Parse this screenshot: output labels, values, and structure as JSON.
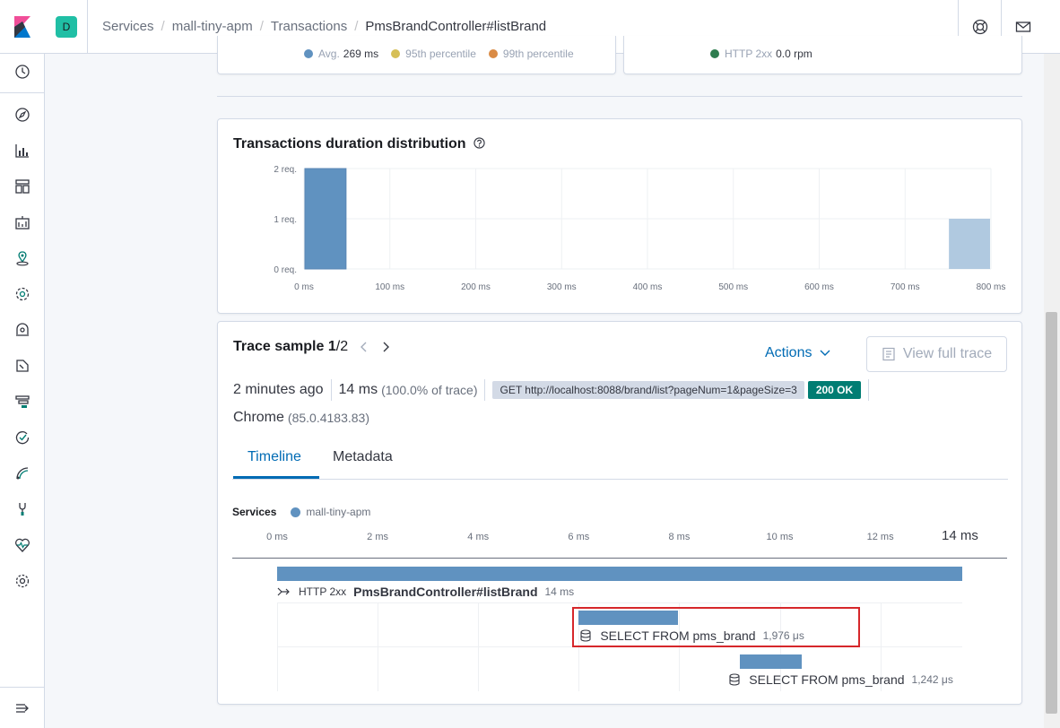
{
  "breadcrumbs": [
    "Services",
    "mall-tiny-apm",
    "Transactions",
    "PmsBrandController#listBrand"
  ],
  "space_initial": "D",
  "colors": {
    "accent": "#006bb4",
    "bar": "#6092c0",
    "bar_light": "#b0c9e0",
    "success": "#017d73",
    "highlight": "#d6272b"
  },
  "latency_legend": [
    {
      "label": "Avg.",
      "value": "269 ms",
      "color": "#6092c0"
    },
    {
      "label": "95th percentile",
      "value": "",
      "color": "#d6bf57"
    },
    {
      "label": "99th percentile",
      "value": "",
      "color": "#da8b45"
    }
  ],
  "throughput_legend": [
    {
      "label": "HTTP 2xx",
      "value": "0.0 rpm",
      "color": "#2e7d4f"
    }
  ],
  "distribution": {
    "title": "Transactions duration distribution"
  },
  "chart_data": {
    "type": "bar",
    "title": "Transactions duration distribution",
    "x_ticks": [
      "0 ms",
      "100 ms",
      "200 ms",
      "300 ms",
      "400 ms",
      "500 ms",
      "600 ms",
      "700 ms",
      "800 ms"
    ],
    "y_ticks": [
      "0 req.",
      "1 req.",
      "2 req."
    ],
    "xlim": [
      0,
      800
    ],
    "ylim": [
      0,
      2
    ],
    "bins": [
      {
        "x0": 0,
        "x1": 50,
        "value": 2,
        "selected": true
      },
      {
        "x0": 750,
        "x1": 800,
        "value": 1,
        "selected": false
      }
    ]
  },
  "trace": {
    "title": "Trace sample",
    "current": "1",
    "total": "/2",
    "actions_label": "Actions",
    "view_full_trace_label": "View full trace",
    "time_ago": "2 minutes ago",
    "duration": "14 ms",
    "duration_pct": "(100.0% of trace)",
    "request": "GET http://localhost:8088/brand/list?pageNum=1&pageSize=3",
    "status": "200 OK",
    "browser": "Chrome",
    "browser_version": "(85.0.4183.83)"
  },
  "tabs": [
    "Timeline",
    "Metadata"
  ],
  "timeline": {
    "services_label": "Services",
    "service_name": "mall-tiny-apm",
    "ticks": [
      "0 ms",
      "2 ms",
      "4 ms",
      "6 ms",
      "8 ms",
      "10 ms",
      "12 ms"
    ],
    "end_label": "14 ms",
    "total_ms": 13.63,
    "spans": [
      {
        "type": "HTTP 2xx",
        "name": "PmsBrandController#listBrand",
        "duration": "14 ms",
        "start_ms": 0,
        "length_ms": 13.63
      },
      {
        "name": "SELECT FROM pms_brand",
        "duration": "1,976 μs",
        "start_ms": 6.0,
        "length_ms": 1.976
      },
      {
        "name": "SELECT FROM pms_brand",
        "duration": "1,242 μs",
        "start_ms": 9.2,
        "length_ms": 1.242
      }
    ]
  }
}
